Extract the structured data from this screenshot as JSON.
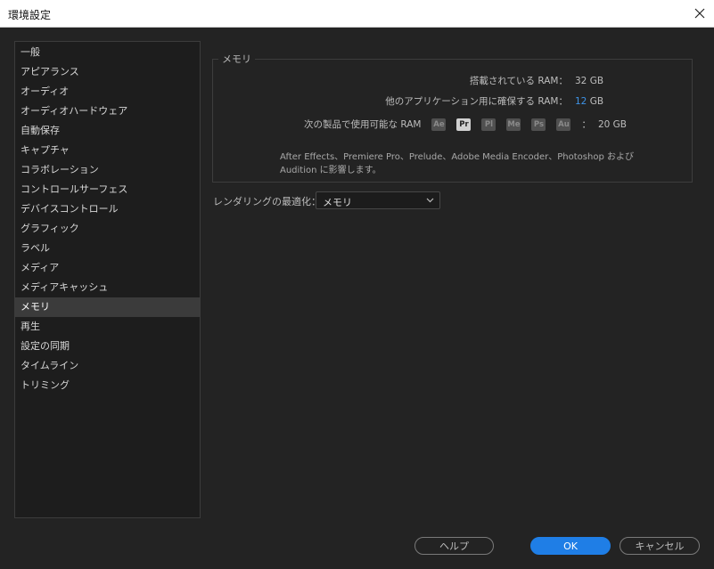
{
  "window": {
    "title": "環境設定"
  },
  "sidebar": {
    "items": [
      {
        "label": "一般"
      },
      {
        "label": "アピアランス"
      },
      {
        "label": "オーディオ"
      },
      {
        "label": "オーディオハードウェア"
      },
      {
        "label": "自動保存"
      },
      {
        "label": "キャプチャ"
      },
      {
        "label": "コラボレーション"
      },
      {
        "label": "コントロールサーフェス"
      },
      {
        "label": "デバイスコントロール"
      },
      {
        "label": "グラフィック"
      },
      {
        "label": "ラベル"
      },
      {
        "label": "メディア"
      },
      {
        "label": "メディアキャッシュ"
      },
      {
        "label": "メモリ",
        "selected": true
      },
      {
        "label": "再生"
      },
      {
        "label": "設定の同期"
      },
      {
        "label": "タイムライン"
      },
      {
        "label": "トリミング"
      }
    ]
  },
  "memory": {
    "legend": "メモリ",
    "installed_label": "搭載されている RAM：",
    "installed_value": "32 GB",
    "reserved_label": "他のアプリケーション用に確保する RAM：",
    "reserved_number": "12",
    "reserved_unit": "GB",
    "available_label": "次の製品で使用可能な RAM",
    "available_sep": "：",
    "available_value": "20 GB",
    "apps": [
      "Ae",
      "Pr",
      "Pl",
      "Me",
      "Ps",
      "Au"
    ],
    "note": "After Effects、Premiere Pro、Prelude、Adobe Media Encoder、Photoshop および Audition に影響します。"
  },
  "rendering": {
    "label": "レンダリングの最適化：",
    "value": "メモリ"
  },
  "footer": {
    "help_label": "ヘルプ",
    "ok_label": "OK",
    "cancel_label": "キャンセル"
  },
  "colors": {
    "background": "#232323",
    "accent": "#1f7ee6",
    "value_accent": "#3d92e6"
  }
}
